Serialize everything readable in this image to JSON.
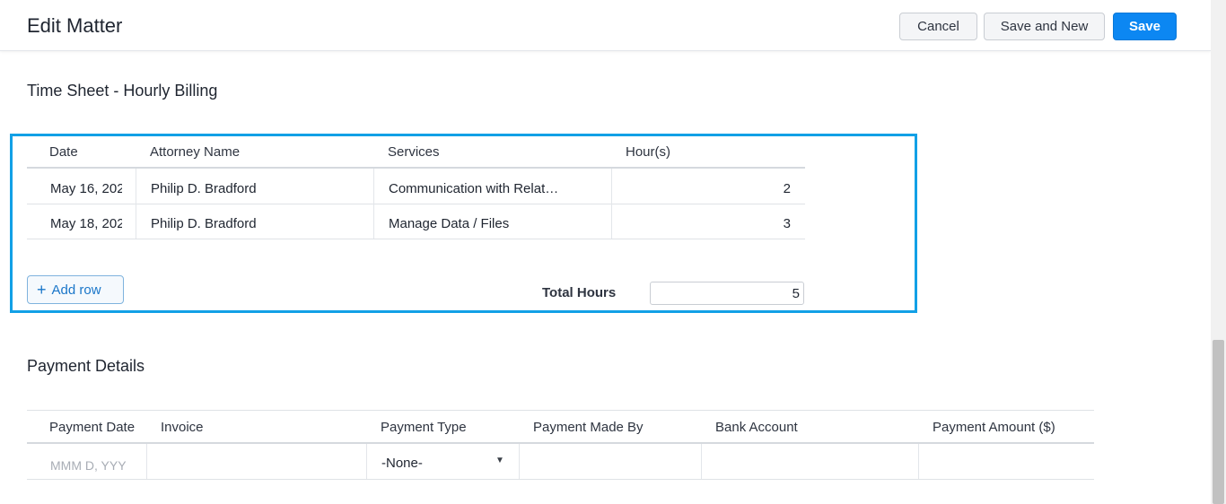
{
  "header": {
    "title": "Edit Matter",
    "cancel_label": "Cancel",
    "save_new_label": "Save and New",
    "save_label": "Save"
  },
  "timesheet": {
    "title": "Time Sheet - Hourly Billing",
    "columns": [
      "Date",
      "Attorney Name",
      "Services",
      "Hour(s)"
    ],
    "rows": [
      {
        "date": "May 16, 202",
        "attorney": "Philip D. Bradford",
        "service": "Communication with Relat…",
        "hours": "2"
      },
      {
        "date": "May 18, 202",
        "attorney": "Philip D. Bradford",
        "service": "Manage Data / Files",
        "hours": "3"
      }
    ],
    "add_row_label": "Add row",
    "total_label": "Total Hours",
    "total_value": "5"
  },
  "payment": {
    "title": "Payment Details",
    "columns": [
      "Payment Date",
      "Invoice",
      "Payment Type",
      "Payment Made By",
      "Bank Account",
      "Payment Amount ($)"
    ],
    "date_placeholder": "MMM D, YYY",
    "type_value": "-None-"
  },
  "colors": {
    "primary": "#0c87f2",
    "highlight": "#12a0e6",
    "link": "#1a76c9"
  }
}
